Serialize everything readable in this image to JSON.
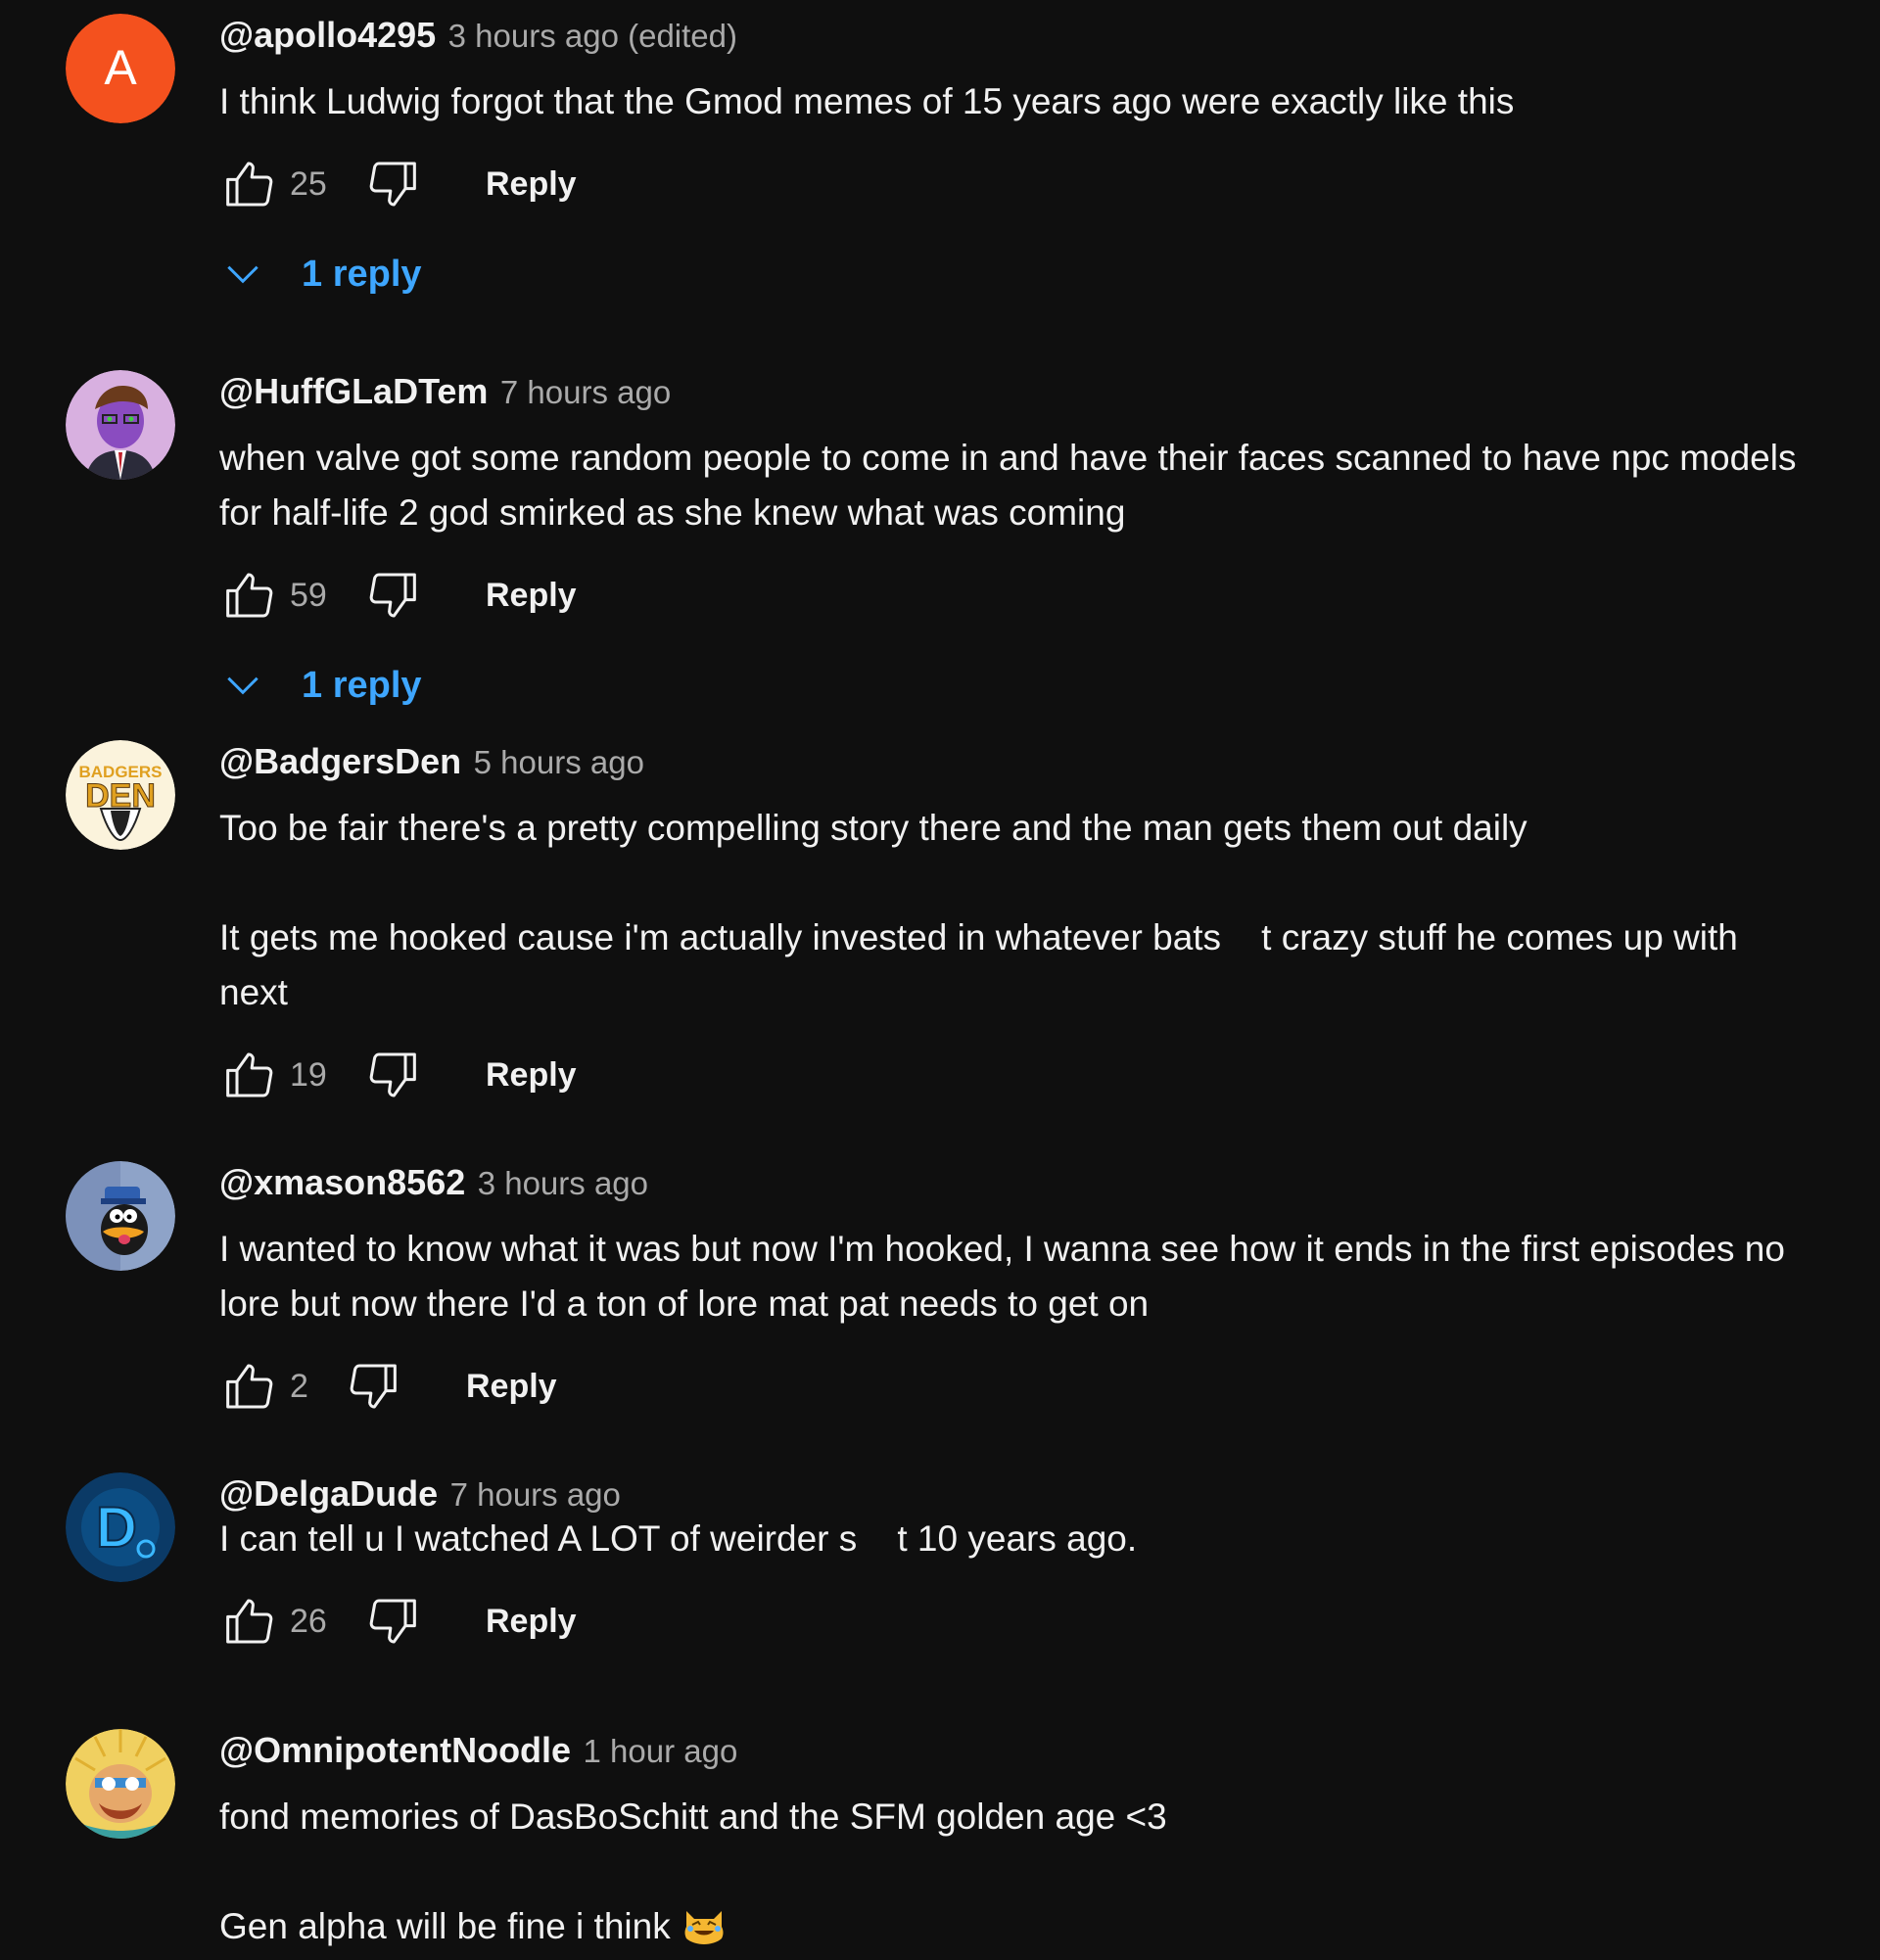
{
  "comments": [
    {
      "handle": "@apollo4295",
      "time": "3 hours ago (edited)",
      "lines": [
        "I think Ludwig forgot that the Gmod memes of 15 years ago were exactly like this"
      ],
      "likes": "25",
      "reply_label": "Reply",
      "replies_label": "1 reply",
      "avatar_letter": "A",
      "avatar_color": "#f4511e"
    },
    {
      "handle": "@HuffGLaDTem",
      "time": "7 hours ago",
      "lines": [
        "when valve got some random people to come in and have their faces scanned to have npc models for half-life 2 god smirked as she knew what was coming"
      ],
      "likes": "59",
      "reply_label": "Reply",
      "replies_label": "1 reply",
      "avatar_color": "#d8b0e0"
    },
    {
      "handle": "@BadgersDen",
      "time": "5 hours ago",
      "lines": [
        "Too be fair there's a pretty compelling story there and the man gets them out daily",
        "",
        "It gets me hooked cause i'm actually invested in whatever bats    t crazy stuff he comes up with next"
      ],
      "likes": "19",
      "reply_label": "Reply",
      "avatar_text_top": "BADGERS",
      "avatar_text_bottom": "DEN",
      "avatar_color": "#fbf3dc"
    },
    {
      "handle": "@xmason8562",
      "time": "3 hours ago",
      "lines": [
        "I wanted to know what it was but now I'm hooked, I wanna see how it ends in the first episodes no lore but now there I'd a ton of lore mat pat needs to get on"
      ],
      "likes": "2",
      "reply_label": "Reply",
      "avatar_color": "#8ea3c8"
    },
    {
      "handle": "@DelgaDude",
      "time": "7 hours ago",
      "lines": [
        "I can tell u I watched A LOT of weirder s    t 10 years ago."
      ],
      "likes": "26",
      "reply_label": "Reply",
      "avatar_letter": "D",
      "avatar_color": "#0b3a66"
    },
    {
      "handle": "@OmnipotentNoodle",
      "time": "1 hour ago",
      "lines": [
        "fond memories of DasBoSchitt and the SFM golden age <3",
        ""
      ],
      "last_line": "Gen alpha will be fine i think",
      "emoji": "cat-joy-emoji",
      "avatar_color": "#f0d060"
    }
  ],
  "icons": {
    "like": "thumbs-up-icon",
    "dislike": "thumbs-down-icon",
    "expand": "chevron-down-icon"
  },
  "colors": {
    "background": "#0f0f0f",
    "text": "#f1f1f1",
    "secondary": "#aaaaaa",
    "link": "#3ea6ff"
  }
}
